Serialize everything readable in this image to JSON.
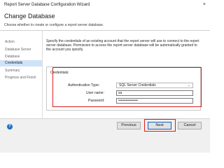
{
  "window": {
    "title": "Report Server Database Configuration Wizard",
    "close_glyph": "×"
  },
  "header": {
    "title": "Change Database",
    "subtitle": "Choose whether to create or configure a report server database."
  },
  "nav": {
    "items": [
      {
        "label": "Action"
      },
      {
        "label": "Database Server"
      },
      {
        "label": "Database"
      },
      {
        "label": "Credentials"
      },
      {
        "label": "Summary"
      },
      {
        "label": "Progress and Finish"
      }
    ],
    "selected": "Credentials"
  },
  "content": {
    "description": "Specify the credentials of an existing account that the report server will use to connect to the report server database.  Permission to access the report server database will be automatically granted to the account you specify.",
    "credentials": {
      "heading": "Credentials:",
      "auth_label": "Authentication Type:",
      "auth_value": "SQL Server Credentials",
      "username_label": "User name:",
      "username_value": "sa",
      "password_label": "Password:",
      "password_value": "••••••••••••••••"
    }
  },
  "footer": {
    "help_icon": "help-icon",
    "previous_label": "Previous",
    "next_label": "Next",
    "cancel_label": "Cancel"
  },
  "colors": {
    "highlight": "#e21b1b",
    "selected_nav": "#cde3f7",
    "help_blue": "#1f6fc5"
  }
}
